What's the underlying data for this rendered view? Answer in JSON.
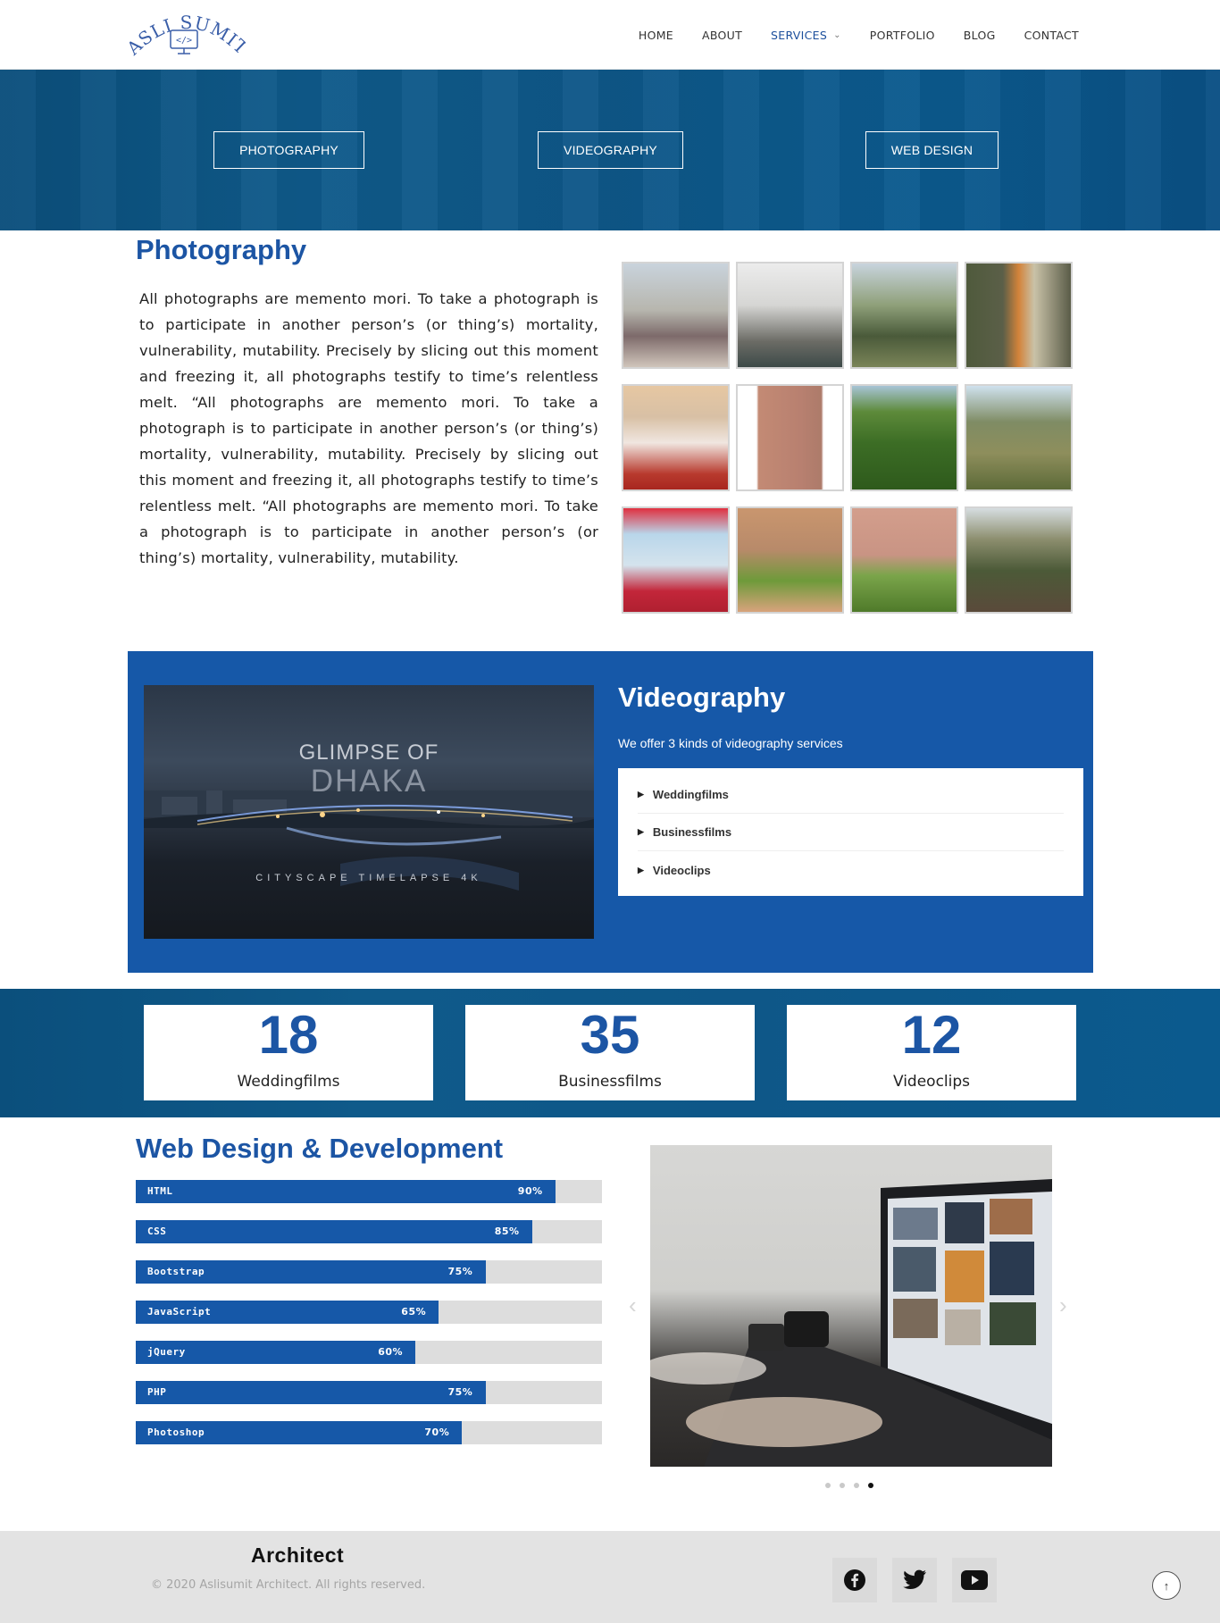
{
  "header": {
    "logo_text": "ASLI SUMIT",
    "logo_code": "</>",
    "nav": [
      {
        "label": "HOME"
      },
      {
        "label": "ABOUT"
      },
      {
        "label": "SERVICES",
        "active": true
      },
      {
        "label": "PORTFOLIO"
      },
      {
        "label": "BLOG"
      },
      {
        "label": "CONTACT"
      }
    ]
  },
  "banner": {
    "buttons": [
      "PHOTOGRAPHY",
      "VIDEOGRAPHY",
      "WEB DESIGN"
    ]
  },
  "photography": {
    "title": "Photography",
    "text": "All photographs are memento mori. To take a photograph is to participate in another person’s (or thing’s) mortality, vulnerability, mutability. Precisely by slicing out this moment and freezing it, all photographs testify to time’s relentless melt. “All photographs are memento mori. To take a photograph is to participate in another person’s (or thing’s) mortality, vulnerability, mutability. Precisely by slicing out this moment and freezing it, all photographs testify to time’s relentless melt. “All photographs are memento mori. To take a photograph is to participate in another person’s (or thing’s) mortality, vulnerability, mutability."
  },
  "videography": {
    "title": "Videography",
    "subtitle": "We offer 3 kinds of videography services",
    "video_title_line1": "GLIMPSE OF",
    "video_title_line2": "DHAKA",
    "video_subtitle": "CITYSCAPE TIMELAPSE 4K",
    "services": [
      "Weddingfilms",
      "Businessfilms",
      "Videoclips"
    ]
  },
  "counters": [
    {
      "value": "18",
      "label": "Weddingfilms"
    },
    {
      "value": "35",
      "label": "Businessfilms"
    },
    {
      "value": "12",
      "label": "Videoclips"
    }
  ],
  "web": {
    "title": "Web Design & Development",
    "skills": [
      {
        "name": "HTML",
        "percent": 90,
        "label": "90%"
      },
      {
        "name": "CSS",
        "percent": 85,
        "label": "85%"
      },
      {
        "name": "Bootstrap",
        "percent": 75,
        "label": "75%"
      },
      {
        "name": "JavaScript",
        "percent": 65,
        "label": "65%"
      },
      {
        "name": "jQuery",
        "percent": 60,
        "label": "60%"
      },
      {
        "name": "PHP",
        "percent": 75,
        "label": "75%"
      },
      {
        "name": "Photoshop",
        "percent": 70,
        "label": "70%"
      }
    ],
    "slider": {
      "slides": 4,
      "active_slide": 4
    }
  },
  "footer": {
    "brand": "Architect",
    "copyright": "© 2020 Aslisumit Architect. All rights reserved.",
    "social": [
      "facebook-icon",
      "twitter-icon",
      "youtube-icon"
    ]
  }
}
